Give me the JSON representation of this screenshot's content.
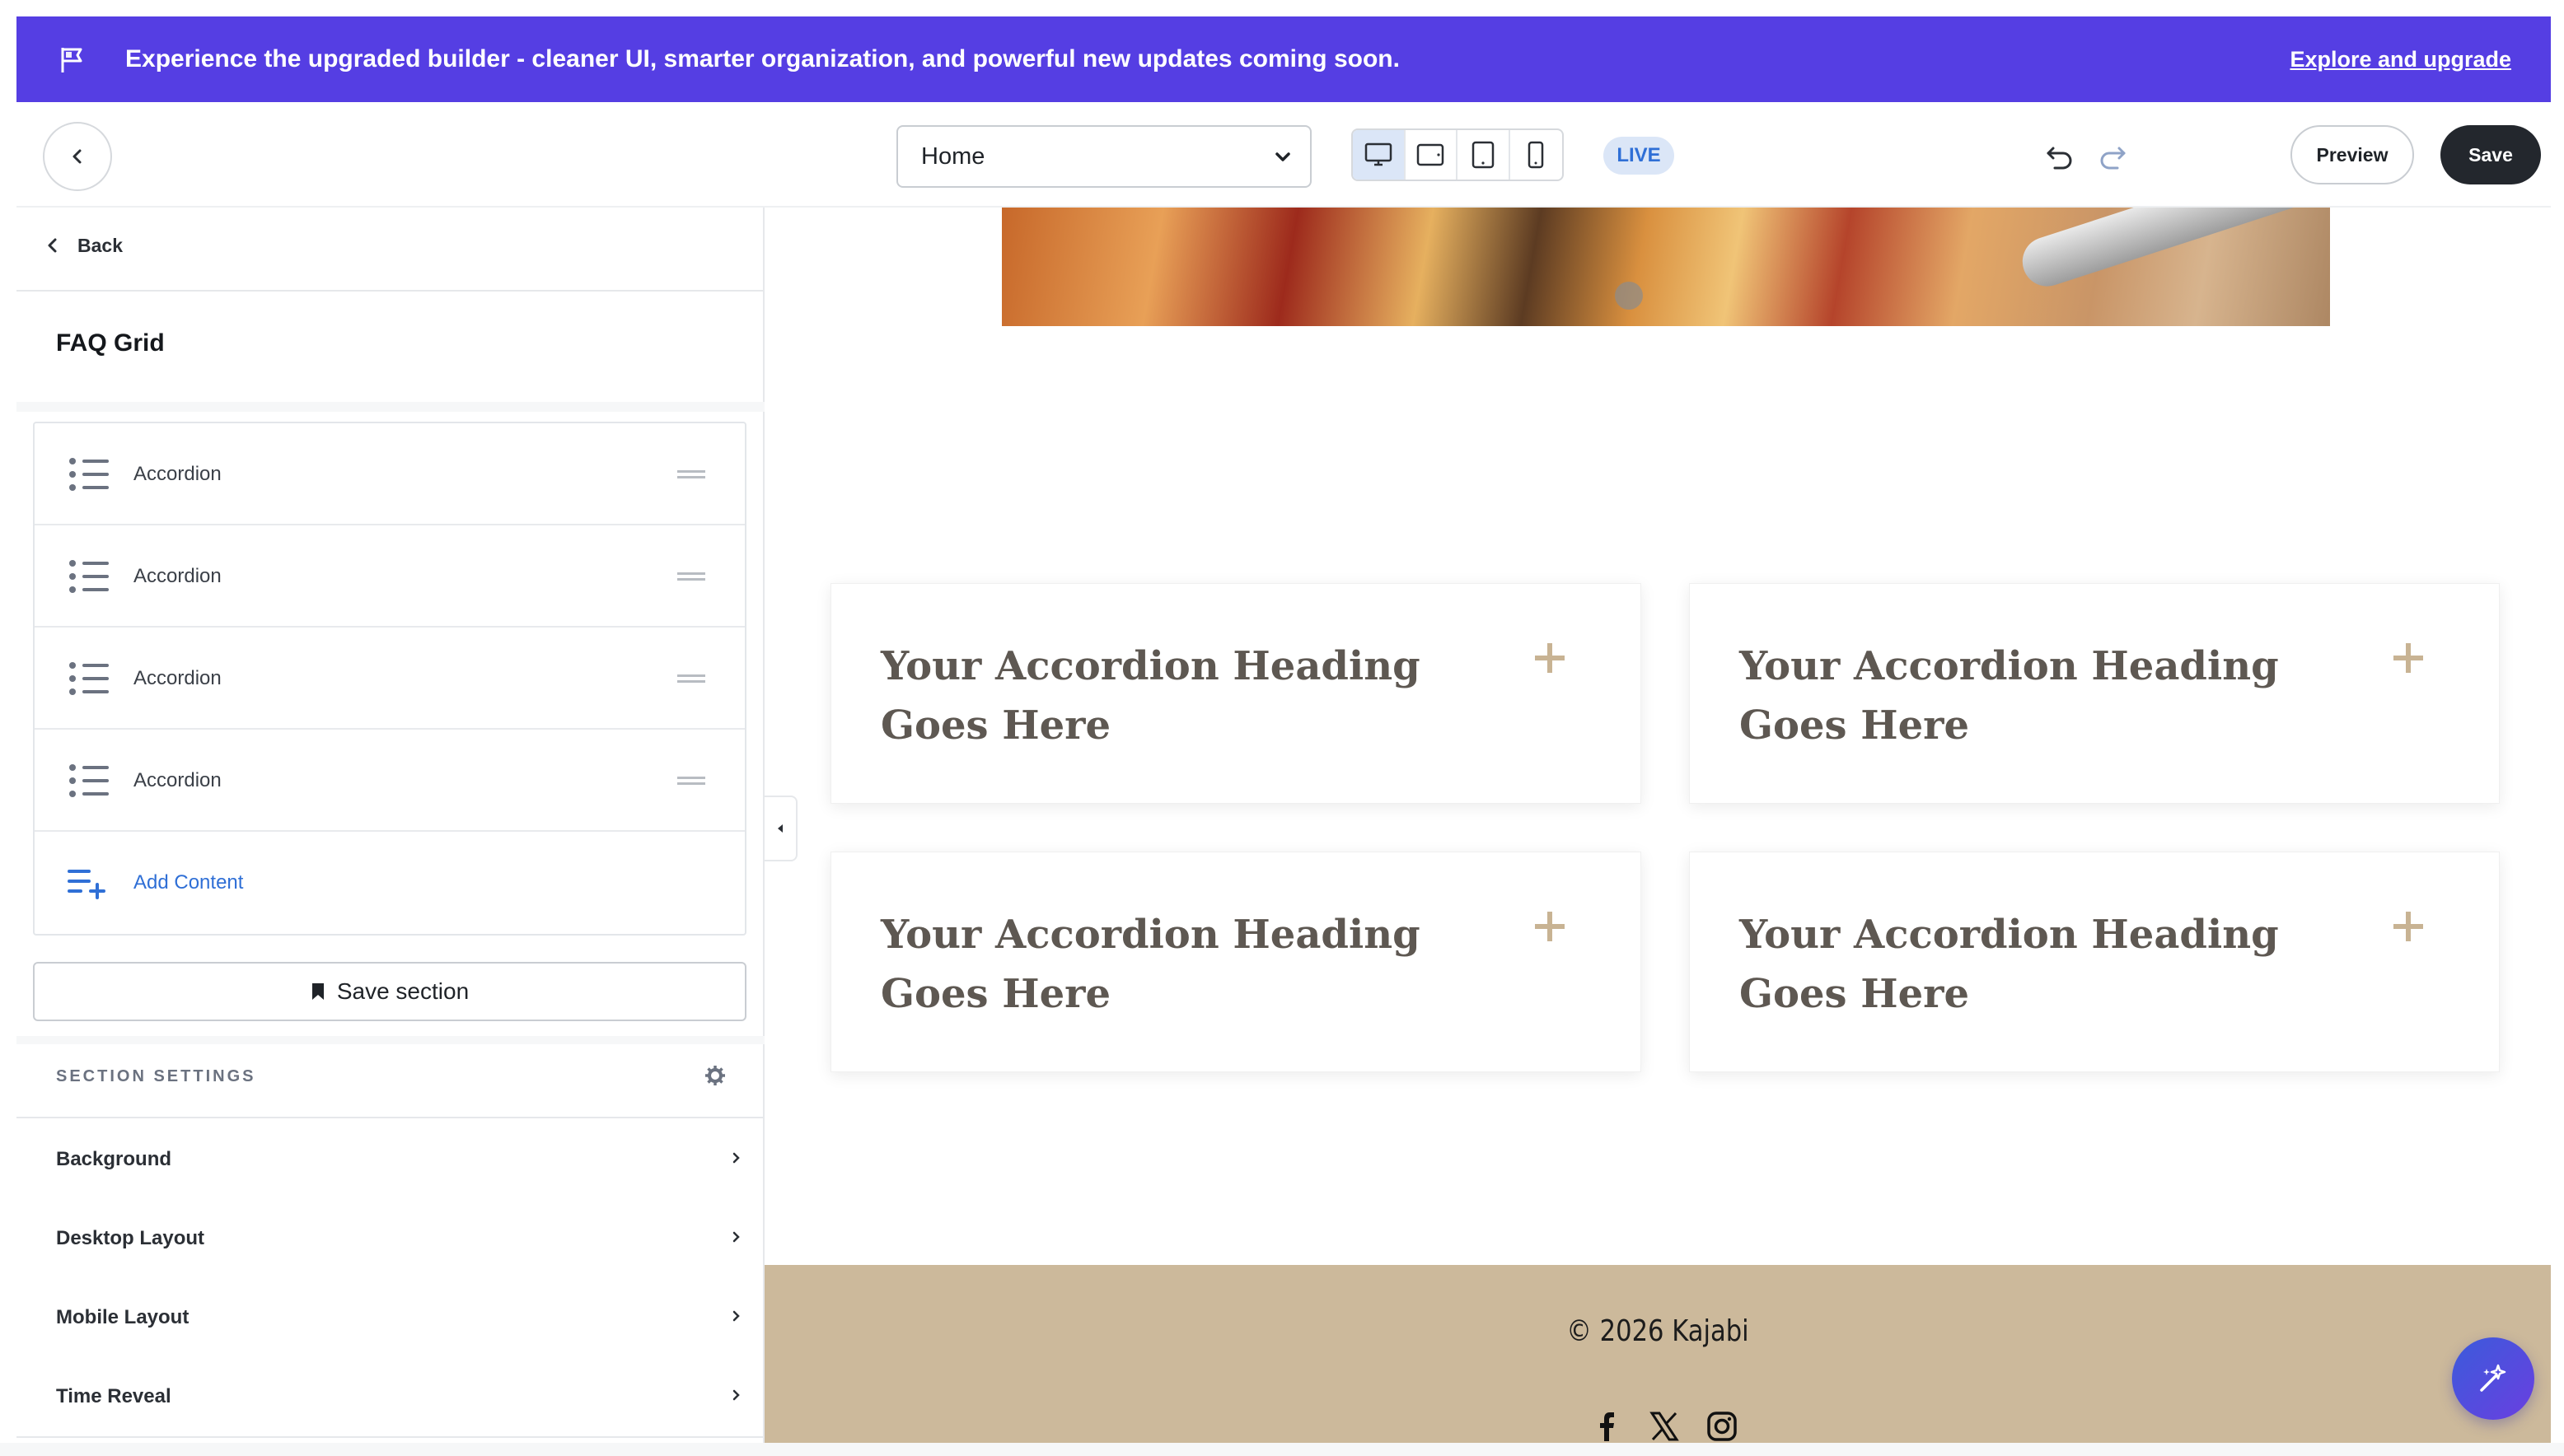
{
  "banner": {
    "message": "Experience the upgraded builder - cleaner UI, smarter organization, and powerful new updates coming soon.",
    "link_label": "Explore and upgrade",
    "background_color": "#553ee3"
  },
  "toolbar": {
    "page_select_value": "Home",
    "devices": [
      "desktop-icon",
      "tablet-landscape-icon",
      "tablet-portrait-icon",
      "mobile-icon"
    ],
    "active_device": "desktop",
    "live_label": "LIVE",
    "preview_label": "Preview",
    "save_label": "Save"
  },
  "sidebar": {
    "back_label": "Back",
    "title": "FAQ Grid",
    "items": [
      {
        "label": "Accordion"
      },
      {
        "label": "Accordion"
      },
      {
        "label": "Accordion"
      },
      {
        "label": "Accordion"
      }
    ],
    "add_content_label": "Add Content",
    "save_section_label": "Save section",
    "settings_heading": "SECTION SETTINGS",
    "settings": [
      {
        "label": "Background"
      },
      {
        "label": "Desktop Layout"
      },
      {
        "label": "Mobile Layout"
      },
      {
        "label": "Time Reveal"
      }
    ]
  },
  "canvas": {
    "faq_items": [
      {
        "heading": "Your Accordion Heading Goes Here"
      },
      {
        "heading": "Your Accordion Heading Goes Here"
      },
      {
        "heading": "Your Accordion Heading Goes Here"
      },
      {
        "heading": "Your Accordion Heading Goes Here"
      }
    ],
    "accent_color": "#c8b393",
    "footer_copyright": "© 2026 Kajabi",
    "footer_color": "#ccb99b",
    "social_icons": [
      "facebook-icon",
      "x-icon",
      "instagram-icon"
    ]
  }
}
